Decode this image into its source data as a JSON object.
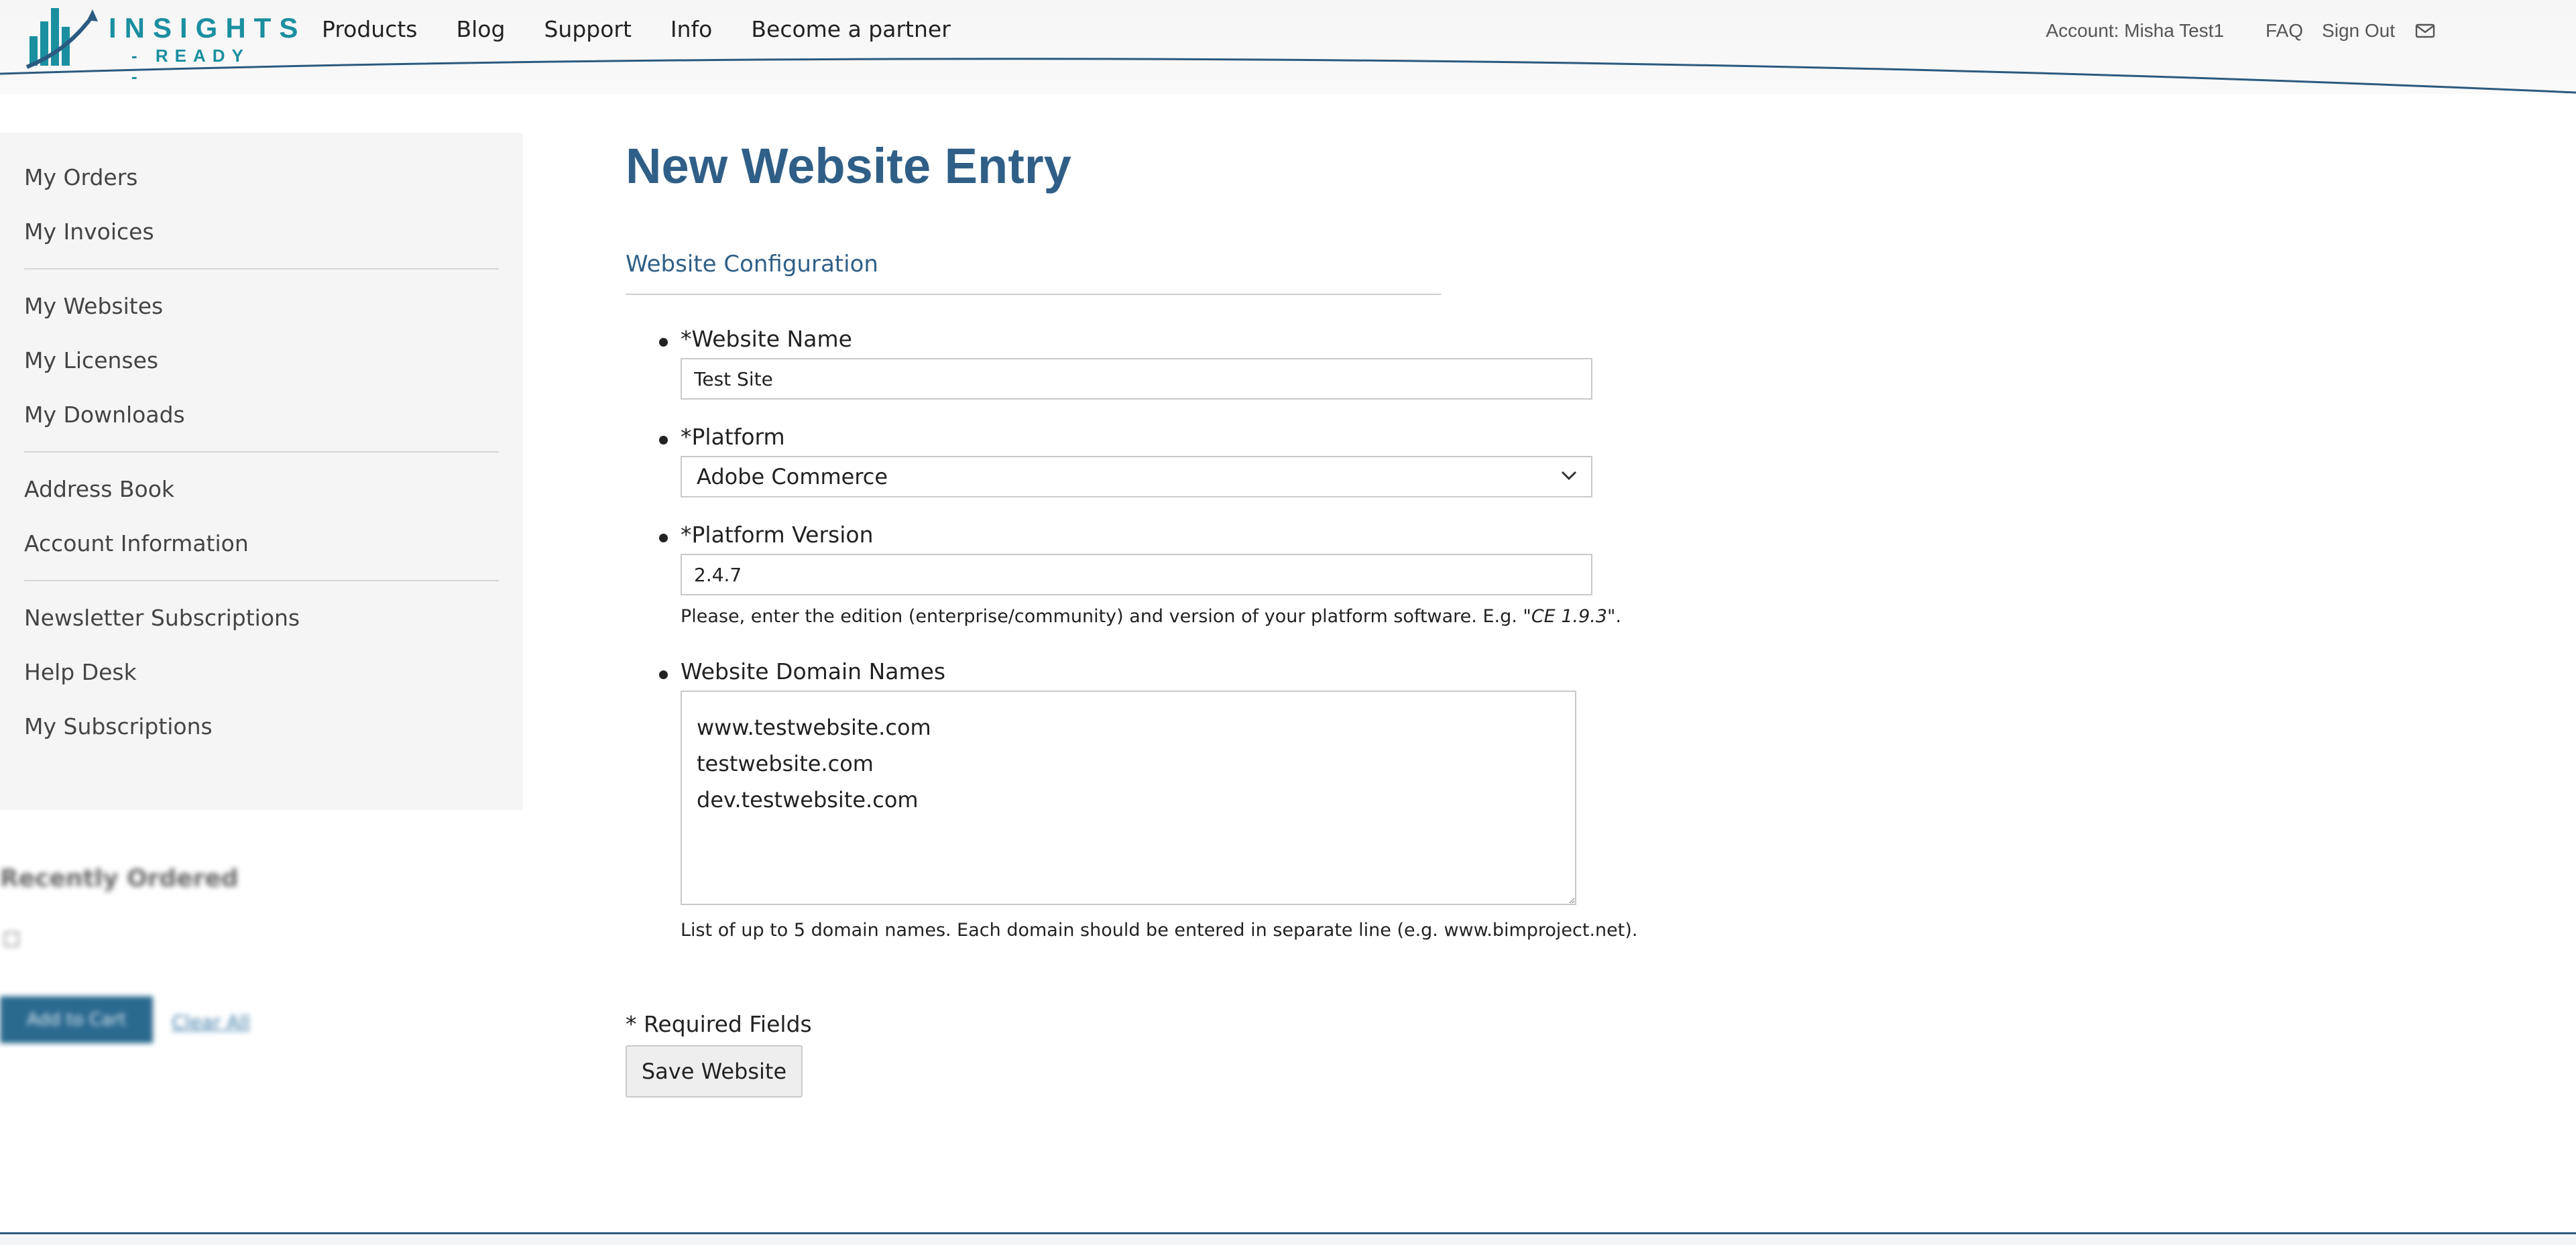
{
  "brand": {
    "name": "INSIGHTS",
    "tagline": "- READY -"
  },
  "nav": [
    "Products",
    "Blog",
    "Support",
    "Info",
    "Become a partner"
  ],
  "account": {
    "label": "Account: Misha Test1",
    "faq": "FAQ",
    "signout": "Sign Out"
  },
  "sidebar": {
    "groups": [
      [
        "My Orders",
        "My Invoices"
      ],
      [
        "My Websites",
        "My Licenses",
        "My Downloads"
      ],
      [
        "Address Book",
        "Account Information"
      ],
      [
        "Newsletter Subscriptions",
        "Help Desk",
        "My Subscriptions"
      ]
    ]
  },
  "recently_ordered": {
    "title": "Recently Ordered",
    "add_to_cart": "Add to Cart",
    "clear_all": "Clear All"
  },
  "page": {
    "title": "New Website Entry",
    "section": "Website Configuration",
    "fields": {
      "website_name": {
        "label": "*Website Name",
        "value": "Test Site"
      },
      "platform": {
        "label": "*Platform",
        "value": "Adobe Commerce"
      },
      "platform_version": {
        "label": "*Platform Version",
        "value": "2.4.7",
        "hint_prefix": "Please, enter the edition (enterprise/community) and version of your platform software. E.g. ",
        "hint_example": "\"CE 1.9.3\"",
        "hint_suffix": "."
      },
      "domains": {
        "label": "Website Domain Names",
        "value": "www.testwebsite.com\ntestwebsite.com\ndev.testwebsite.com",
        "hint": "List of up to 5 domain names. Each domain should be entered in separate line (e.g. www.bimproject.net)."
      }
    },
    "required_note": "* Required Fields",
    "save_label": "Save Website"
  },
  "colors": {
    "brand_teal": "#1a8fa0",
    "heading_blue": "#2f5f87",
    "sidebar_bg": "#f5f5f5"
  }
}
